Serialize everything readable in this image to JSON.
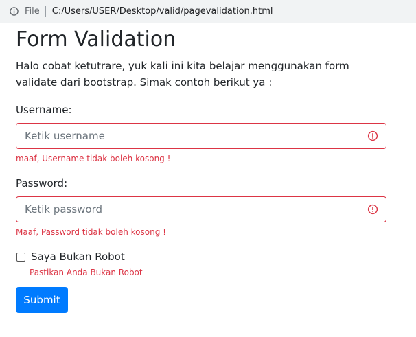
{
  "browser": {
    "file_label": "File",
    "url": "C:/Users/USER/Desktop/valid/pagevalidation.html",
    "icon": "info-icon"
  },
  "page": {
    "title": "Form Validation",
    "intro": "Halo cobat ketutrare, yuk kali ini kita belajar menggunakan form validate dari bootstrap. Simak contoh berikut ya :"
  },
  "form": {
    "username": {
      "label": "Username:",
      "placeholder": "Ketik username",
      "value": "",
      "error": "maaf, Username tidak boleh kosong !",
      "icon": "alert-circle-icon"
    },
    "password": {
      "label": "Password:",
      "placeholder": "Ketik password",
      "value": "",
      "error": "Maaf, Password tidak boleh kosong !",
      "icon": "alert-circle-icon"
    },
    "robot": {
      "label": "Saya Bukan Robot",
      "checked": false,
      "error": "Pastikan Anda Bukan Robot"
    },
    "submit_label": "Submit"
  },
  "colors": {
    "error": "#dc3545",
    "primary": "#007bff",
    "text": "#212529"
  }
}
